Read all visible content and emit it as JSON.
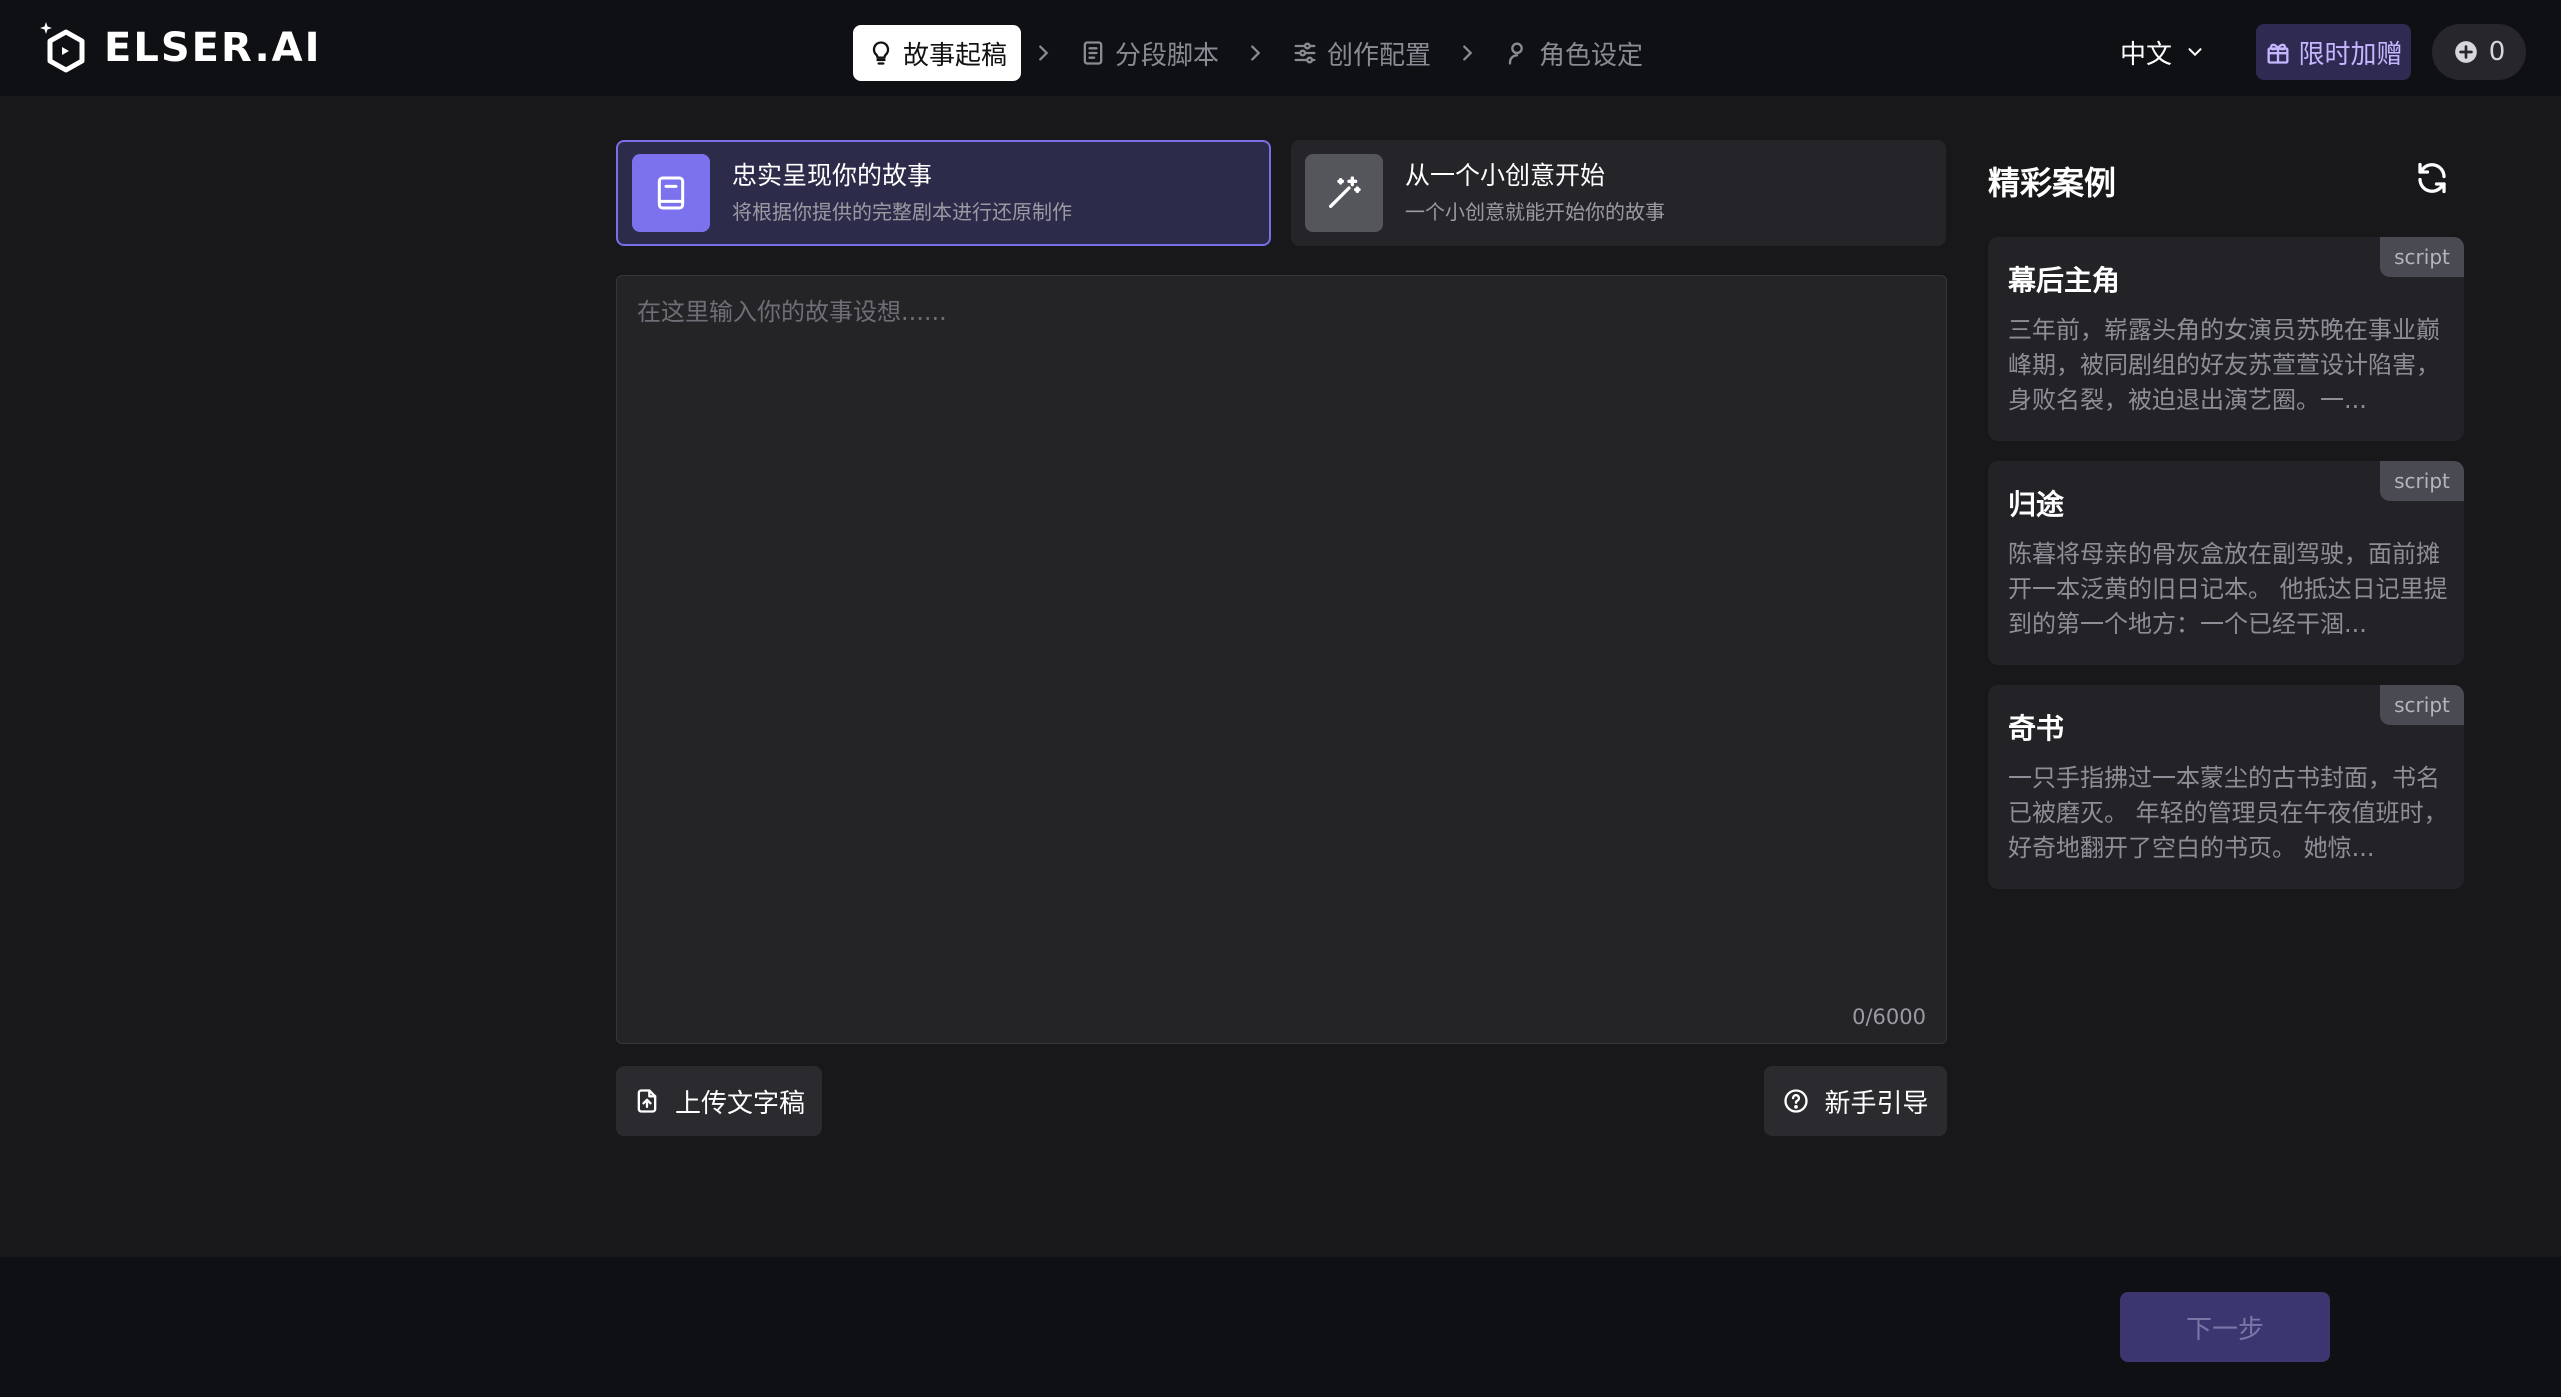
{
  "header": {
    "logo_text": "ELSER.AI",
    "steps": [
      {
        "label": "故事起稿",
        "icon": "lightbulb-icon",
        "active": true
      },
      {
        "label": "分段脚本",
        "icon": "document-icon",
        "active": false
      },
      {
        "label": "创作配置",
        "icon": "sliders-icon",
        "active": false
      },
      {
        "label": "角色设定",
        "icon": "user-icon",
        "active": false
      }
    ],
    "language": "中文",
    "promo_label": "限时加赠",
    "credits": "0"
  },
  "modes": [
    {
      "title": "忠实呈现你的故事",
      "subtitle": "将根据你提供的完整剧本进行还原制作",
      "selected": true,
      "icon": "book-icon"
    },
    {
      "title": "从一个小创意开始",
      "subtitle": "一个小创意就能开始你的故事",
      "selected": false,
      "icon": "magic-wand-icon"
    }
  ],
  "editor": {
    "placeholder": "在这里输入你的故事设想......",
    "counter": "0/6000"
  },
  "actions": {
    "upload_label": "上传文字稿",
    "guide_label": "新手引导",
    "next_label": "下一步"
  },
  "cases": {
    "title": "精彩案例",
    "items": [
      {
        "tag": "script",
        "title": "幕后主角",
        "body": "三年前，崭露头角的女演员苏晚在事业巅峰期，被同剧组的好友苏萱萱设计陷害，身败名裂，被迫退出演艺圈。一..."
      },
      {
        "tag": "script",
        "title": "归途",
        "body": "陈暮将母亲的骨灰盒放在副驾驶，面前摊开一本泛黄的旧日记本。 他抵达日记里提到的第一个地方：一个已经干涸..."
      },
      {
        "tag": "script",
        "title": "奇书",
        "body": "一只手指拂过一本蒙尘的古书封面，书名已被磨灭。 年轻的管理员在午夜值班时，好奇地翻开了空白的书页。 她惊..."
      }
    ]
  },
  "colors": {
    "accent": "#7d72ee",
    "background": "#18181b",
    "header": "#0f1014"
  }
}
